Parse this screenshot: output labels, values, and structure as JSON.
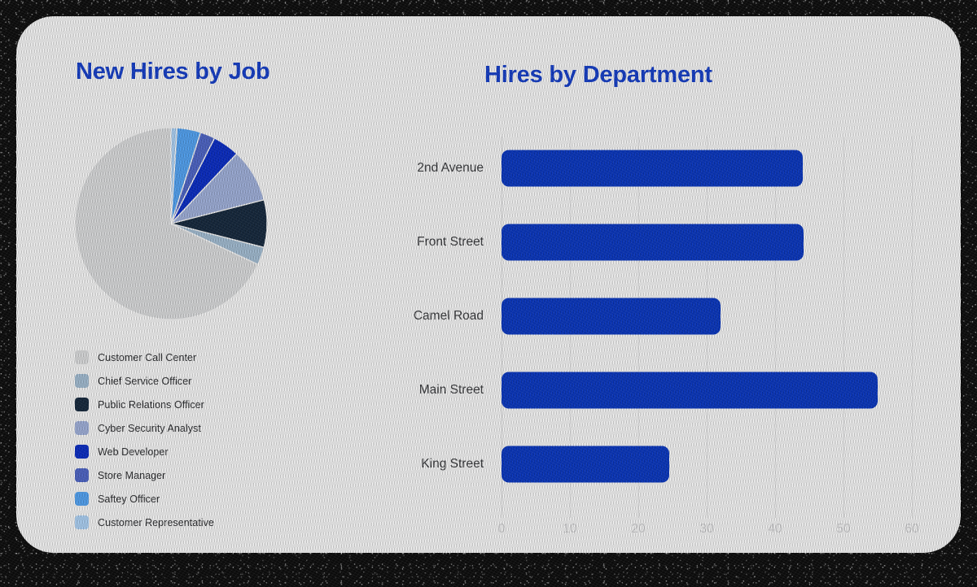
{
  "theme": {
    "card_background": "#ffffff",
    "title_color": "#1540d0",
    "bar_color": "#0a39c7",
    "grid_color": "#ececed",
    "tick_label_color": "#d8d8da",
    "category_label_color": "#3c3d40",
    "legend_label_color": "#2f3033"
  },
  "panels": {
    "pie": {
      "title": "New Hires by Job"
    },
    "bar": {
      "title": "Hires by Department"
    }
  },
  "legend": {
    "items": [
      {
        "label": "Customer Call Center",
        "color": "#e3e4e5"
      },
      {
        "label": "Chief Service Officer",
        "color": "#a8c3da"
      },
      {
        "label": "Public Relations Officer",
        "color": "#16293f"
      },
      {
        "label": "Cyber Security Analyst",
        "color": "#a5b6e2"
      },
      {
        "label": "Web Developer",
        "color": "#0a2ecb"
      },
      {
        "label": "Store Manager",
        "color": "#5068cd"
      },
      {
        "label": "Saftey Officer",
        "color": "#55a8fb"
      },
      {
        "label": "Customer Representative",
        "color": "#b2d8fd"
      }
    ]
  },
  "chart_data": [
    {
      "type": "pie",
      "title": "New Hires by Job",
      "categories": [
        "Customer Call Center",
        "Chief Service Officer",
        "Public Relations Officer",
        "Cyber Security Analyst",
        "Web Developer",
        "Store Manager",
        "Saftey Officer",
        "Customer Representative"
      ],
      "values": [
        68,
        3,
        8,
        9,
        4.5,
        2.5,
        4,
        1
      ],
      "units": "percent",
      "colors": [
        "#e3e4e5",
        "#a8c3da",
        "#16293f",
        "#a5b6e2",
        "#0a2ecb",
        "#5068cd",
        "#55a8fb",
        "#b2d8fd"
      ],
      "legend_position": "bottom-left",
      "start_angle_deg": -90,
      "direction": "counterclockwise"
    },
    {
      "type": "bar",
      "orientation": "horizontal",
      "title": "Hires by Department",
      "categories": [
        "2nd Avenue",
        "Front Street",
        "Camel Road",
        "Main Street",
        "King Street"
      ],
      "values": [
        44,
        44.2,
        32,
        55,
        24.5
      ],
      "xlabel": "",
      "ylabel": "",
      "xlim": [
        0,
        60
      ],
      "xticks": [
        0,
        10,
        20,
        30,
        40,
        50,
        60
      ],
      "xtick_labels": [
        "0",
        "10",
        "20",
        "30",
        "40",
        "50",
        "60"
      ],
      "grid": "vertical",
      "legend_position": "none",
      "bar_color": "#0a39c7"
    }
  ]
}
